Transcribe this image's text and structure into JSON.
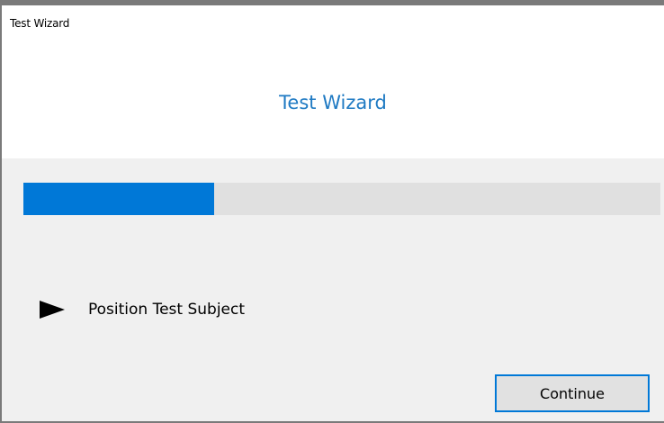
{
  "window": {
    "title": "Test Wizard"
  },
  "header": {
    "title": "Test Wizard"
  },
  "progress": {
    "fraction": 0.3
  },
  "step": {
    "icon": "play-icon",
    "label": "Position Test Subject"
  },
  "actions": {
    "continue_label": "Continue"
  },
  "colors": {
    "accent": "#0078d7",
    "header_title": "#1f7ac3",
    "progress_track": "#e0e0e0"
  }
}
